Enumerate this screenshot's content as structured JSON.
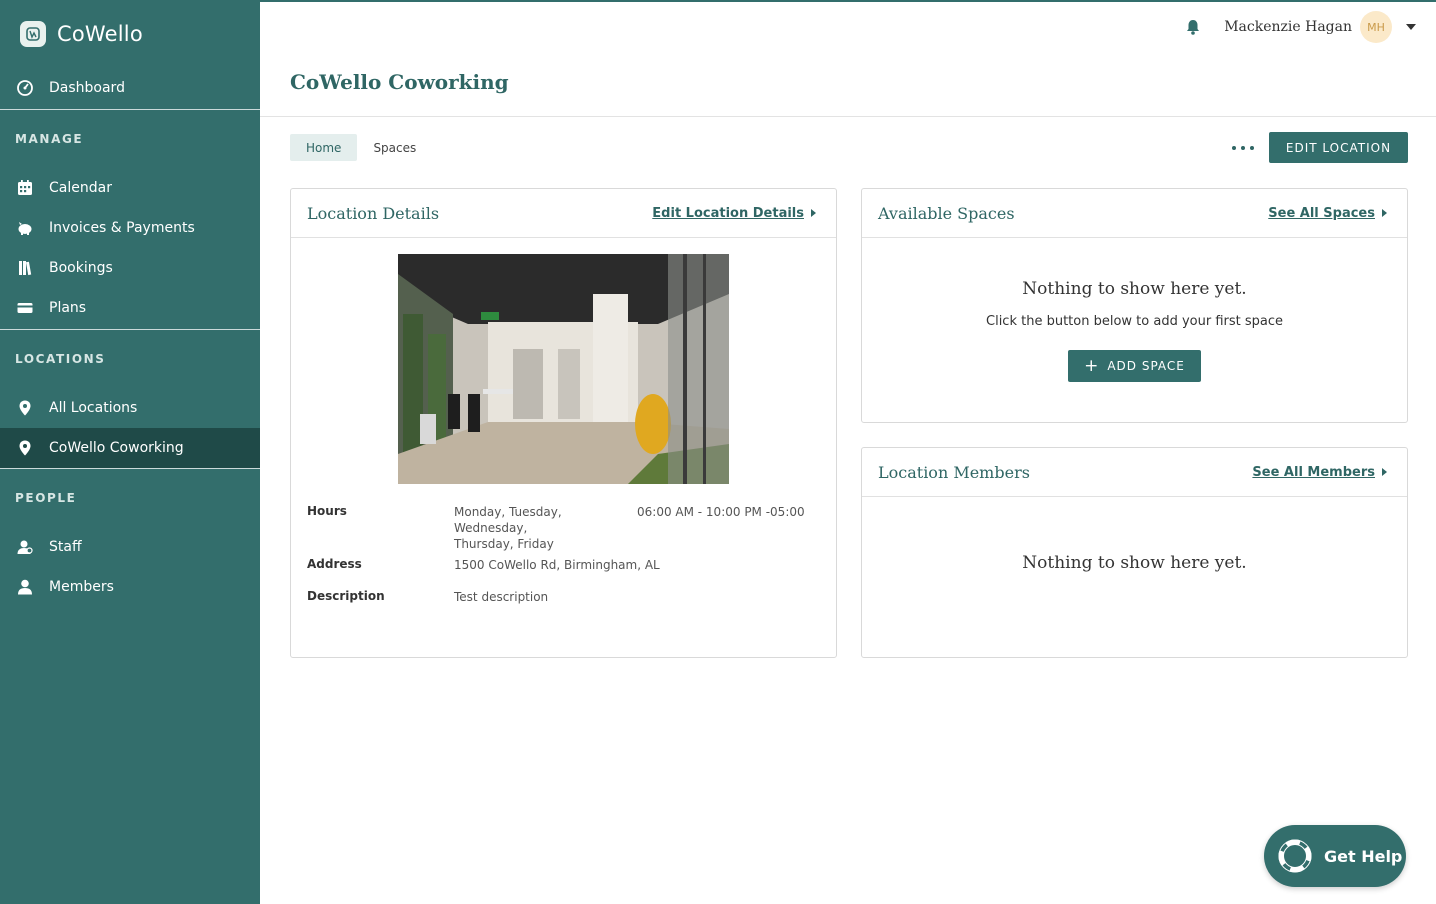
{
  "brand": {
    "name": "CoWello"
  },
  "sidebar": {
    "dashboard": "Dashboard",
    "sections": [
      {
        "heading": "MANAGE",
        "items": [
          "Calendar",
          "Invoices & Payments",
          "Bookings",
          "Plans"
        ]
      },
      {
        "heading": "LOCATIONS",
        "items": [
          "All Locations",
          "CoWello Coworking"
        ]
      },
      {
        "heading": "PEOPLE",
        "items": [
          "Staff",
          "Members"
        ]
      }
    ],
    "active_item": "CoWello Coworking"
  },
  "header": {
    "user_name": "Mackenzie Hagan",
    "user_initials": "MH"
  },
  "page": {
    "title": "CoWello Coworking"
  },
  "tabs": {
    "home": "Home",
    "spaces": "Spaces",
    "edit_location": "EDIT LOCATION"
  },
  "location_details": {
    "title": "Location Details",
    "edit_link": "Edit Location Details",
    "hours_label": "Hours",
    "hours_days": "Monday, Tuesday, Wednesday,\nThursday, Friday",
    "hours_time": "06:00 AM - 10:00 PM -05:00",
    "address_label": "Address",
    "address": "1500 CoWello Rd, Birmingham, AL",
    "description_label": "Description",
    "description": "Test description"
  },
  "available_spaces": {
    "title": "Available Spaces",
    "link": "See All Spaces",
    "empty_title": "Nothing to show here yet.",
    "empty_sub": "Click the button below to add your first space",
    "add_button": "ADD SPACE"
  },
  "location_members": {
    "title": "Location Members",
    "link": "See All Members",
    "empty_title": "Nothing to show here yet."
  },
  "help": {
    "label": "Get Help"
  },
  "colors": {
    "primary": "#336e6c",
    "active_nav": "#1f4a48",
    "avatar_bg": "#fbe9c9"
  }
}
